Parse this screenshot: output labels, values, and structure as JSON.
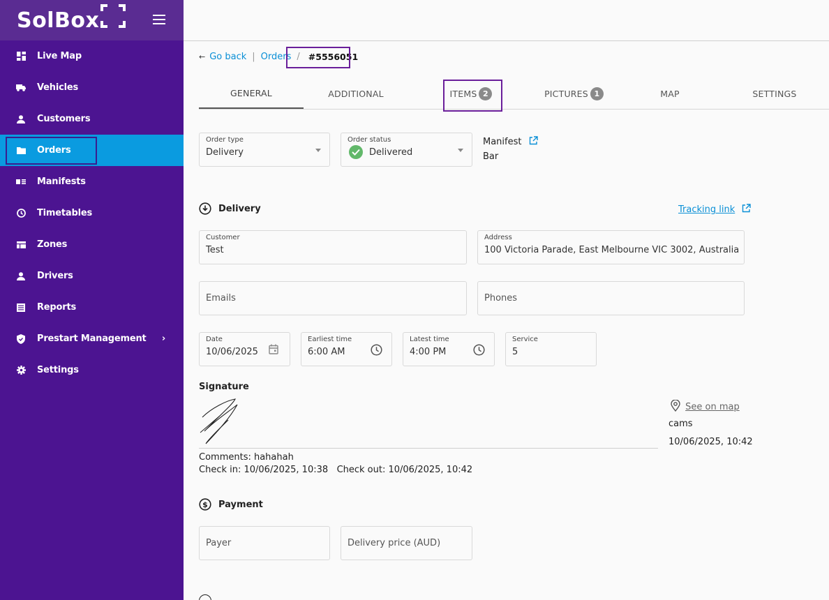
{
  "brand": {
    "name": "SolBox"
  },
  "sidebar": {
    "items": [
      {
        "label": "Live Map",
        "icon": "dashboard-icon"
      },
      {
        "label": "Vehicles",
        "icon": "truck-icon"
      },
      {
        "label": "Customers",
        "icon": "person-icon"
      },
      {
        "label": "Orders",
        "icon": "folder-icon"
      },
      {
        "label": "Manifests",
        "icon": "manifest-icon"
      },
      {
        "label": "Timetables",
        "icon": "clock-icon"
      },
      {
        "label": "Zones",
        "icon": "zones-icon"
      },
      {
        "label": "Drivers",
        "icon": "person-icon"
      },
      {
        "label": "Reports",
        "icon": "report-icon"
      },
      {
        "label": "Prestart Management",
        "icon": "shield-icon"
      },
      {
        "label": "Settings",
        "icon": "gear-icon"
      }
    ],
    "active_index": 3,
    "accent": "#0a9be0",
    "background": "#4c1491"
  },
  "breadcrumb": {
    "back": "Go back",
    "orders": "Orders",
    "sep1": "|",
    "sep2": "/",
    "order_id": "#5556051"
  },
  "tabs": [
    {
      "label": "GENERAL"
    },
    {
      "label": "ADDITIONAL"
    },
    {
      "label": "ITEMS",
      "badge": "2"
    },
    {
      "label": "PICTURES",
      "badge": "1"
    },
    {
      "label": "MAP"
    },
    {
      "label": "SETTINGS"
    }
  ],
  "order": {
    "type_label": "Order type",
    "type_value": "Delivery",
    "status_label": "Order status",
    "status_value": "Delivered",
    "manifest_label": "Manifest",
    "manifest_value": "Bar"
  },
  "delivery": {
    "title": "Delivery",
    "tracking_link": "Tracking link",
    "customer_label": "Customer",
    "customer_value": "Test",
    "address_label": "Address",
    "address_value": "100 Victoria Parade, East Melbourne VIC 3002, Australia",
    "emails_placeholder": "Emails",
    "phones_placeholder": "Phones",
    "date_label": "Date",
    "date_value": "10/06/2025",
    "earliest_label": "Earliest time",
    "earliest_value": "6:00 AM",
    "latest_label": "Latest time",
    "latest_value": "4:00 PM",
    "service_label": "Service",
    "service_value": "5"
  },
  "signature": {
    "title": "Signature",
    "comments": "Comments: hahahah",
    "checkin": "Check in: 10/06/2025, 10:38",
    "checkout": "Check out: 10/06/2025, 10:42",
    "see_on_map": "See on map",
    "signer": "cams",
    "signed_at": "10/06/2025, 10:42"
  },
  "payment": {
    "title": "Payment",
    "payer_placeholder": "Payer",
    "price_placeholder": "Delivery price (AUD)"
  }
}
